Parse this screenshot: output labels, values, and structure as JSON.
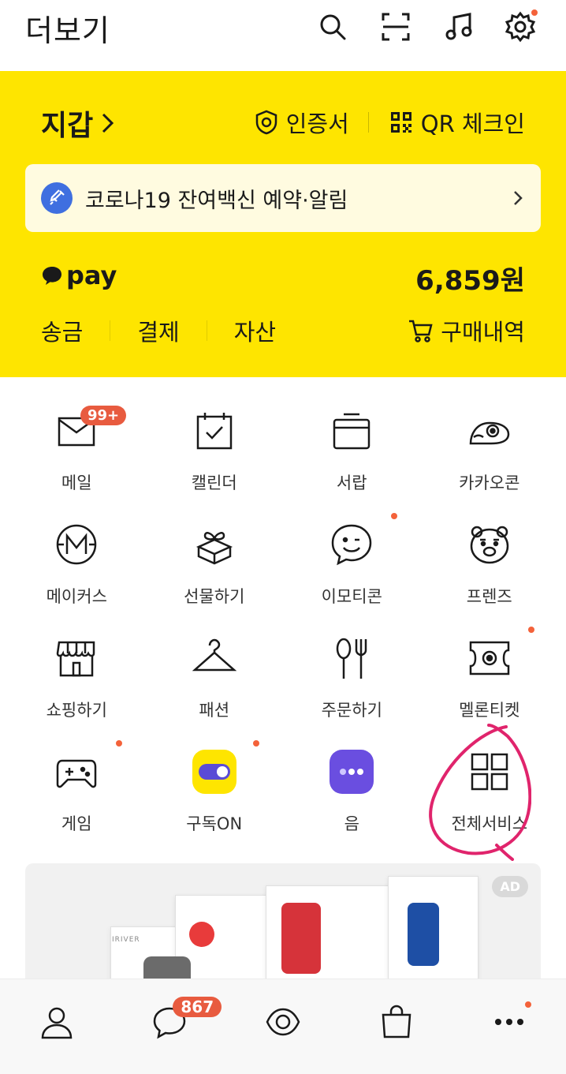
{
  "header": {
    "title": "더보기",
    "icons": [
      "search-icon",
      "scan-icon",
      "music-icon",
      "settings-icon"
    ]
  },
  "wallet": {
    "title": "지갑",
    "certificate_label": "인증서",
    "qr_label": "QR 체크인",
    "banner_text": "코로나19 잔여백신 예약·알림",
    "pay_logo": "pay",
    "pay_amount": "6,859원",
    "actions": [
      "송금",
      "결제",
      "자산"
    ],
    "purchase_label": "구매내역"
  },
  "services": [
    {
      "label": "메일",
      "icon": "mail-icon",
      "badge": "99+"
    },
    {
      "label": "캘린더",
      "icon": "calendar-icon"
    },
    {
      "label": "서랍",
      "icon": "drawer-icon"
    },
    {
      "label": "카카오콘",
      "icon": "kakaocon-icon"
    },
    {
      "label": "메이커스",
      "icon": "makers-icon"
    },
    {
      "label": "선물하기",
      "icon": "gift-icon"
    },
    {
      "label": "이모티콘",
      "icon": "emoticon-icon",
      "dot": true
    },
    {
      "label": "프렌즈",
      "icon": "friends-icon"
    },
    {
      "label": "쇼핑하기",
      "icon": "shopping-icon"
    },
    {
      "label": "패션",
      "icon": "hanger-icon"
    },
    {
      "label": "주문하기",
      "icon": "order-icon"
    },
    {
      "label": "멜론티켓",
      "icon": "ticket-icon",
      "dot": true
    },
    {
      "label": "게임",
      "icon": "game-icon",
      "dot": true
    },
    {
      "label": "구독ON",
      "icon": "subscription-icon",
      "dot": true
    },
    {
      "label": "음",
      "icon": "eum-icon"
    },
    {
      "label": "전체서비스",
      "icon": "all-services-icon"
    }
  ],
  "ad": {
    "badge": "AD",
    "brand": "IRIVER"
  },
  "bottom_nav": {
    "chat_badge": "867",
    "items": [
      "friends-tab",
      "chat-tab",
      "view-tab",
      "shopping-tab",
      "more-tab"
    ]
  },
  "colors": {
    "wallet_bg": "#fee500",
    "badge": "#e85b3f",
    "highlight": "#e0246c"
  }
}
